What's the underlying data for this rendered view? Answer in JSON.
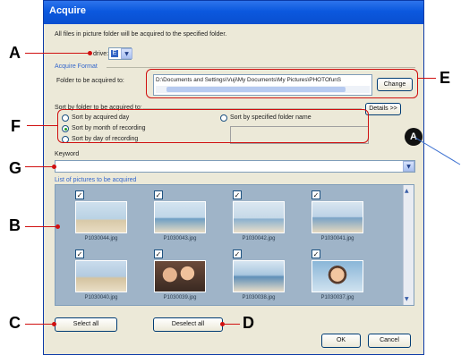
{
  "dialog": {
    "title": "Acquire",
    "intro": "All files in picture folder will be acquired to the specified folder.",
    "drive_label": "drive:",
    "drive_value": "E",
    "format_heading": "Acquire Format",
    "folder_label": "Folder to be acquired to:",
    "folder_path": "D:\\Documents and Settings\\Vuji\\My Documents\\My Pictures\\PHOTOfunS",
    "change_button": "Change",
    "sort_heading": "Sort by folder to be acquired to:",
    "details_button": "Details >>",
    "sort_options": [
      {
        "label": "Sort by acquired day",
        "selected": false
      },
      {
        "label": "Sort by month of recording",
        "selected": true
      },
      {
        "label": "Sort by day of recording",
        "selected": false
      },
      {
        "label": "Sort by specified folder name",
        "selected": false
      }
    ],
    "keyword_label": "Keyword",
    "keyword_value": "",
    "list_heading": "List of pictures to be acquired",
    "pictures": [
      {
        "name": "P1030044.jpg",
        "checked": true
      },
      {
        "name": "P1030043.jpg",
        "checked": true
      },
      {
        "name": "P1030042.jpg",
        "checked": true
      },
      {
        "name": "P1030041.jpg",
        "checked": true
      },
      {
        "name": "P1030040.jpg",
        "checked": true
      },
      {
        "name": "P1030039.jpg",
        "checked": true
      },
      {
        "name": "P1030038.jpg",
        "checked": true
      },
      {
        "name": "P1030037.jpg",
        "checked": true
      }
    ],
    "select_all_button": "Select all",
    "deselect_all_button": "Deselect all",
    "ok_button": "OK",
    "cancel_button": "Cancel"
  },
  "callouts": {
    "a": "A",
    "b": "B",
    "c": "C",
    "d": "D",
    "e": "E",
    "f": "F",
    "g": "G",
    "badge": "A"
  },
  "colors": {
    "titlebar": "#0b58de",
    "callout_line": "#d01010",
    "list_background": "#9fb4c8"
  }
}
